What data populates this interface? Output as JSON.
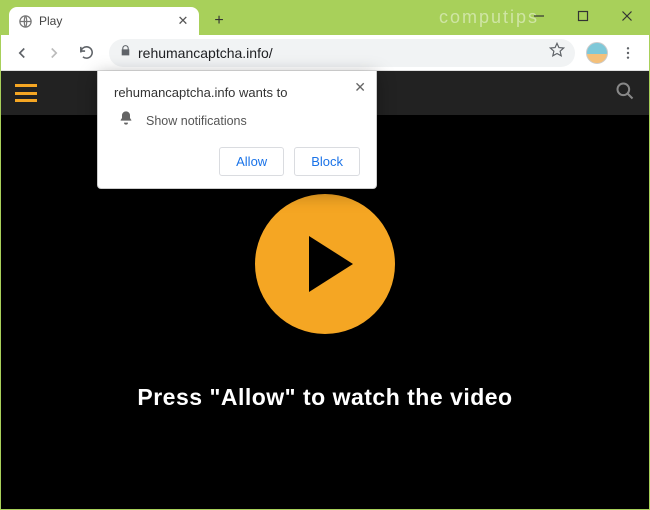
{
  "window": {
    "watermark": "computips"
  },
  "tab": {
    "title": "Play"
  },
  "address": {
    "url": "rehumancaptcha.info/"
  },
  "site": {
    "instruction": "Press \"Allow\" to watch the video"
  },
  "permission": {
    "origin_wants_to": "rehumancaptcha.info wants to",
    "capability": "Show notifications",
    "allow": "Allow",
    "block": "Block"
  }
}
